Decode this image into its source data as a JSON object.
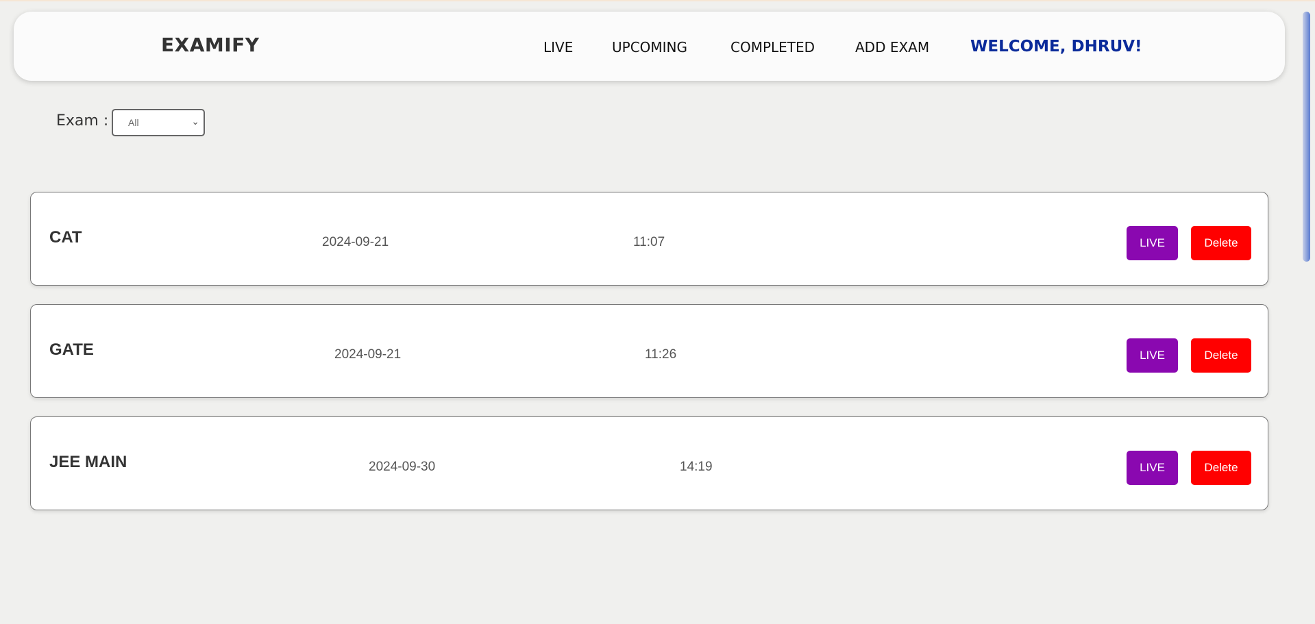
{
  "header": {
    "brand": "EXAMIFY",
    "nav": [
      "LIVE",
      "UPCOMING",
      "COMPLETED",
      "ADD EXAM"
    ],
    "welcome": "WELCOME, DHRUV!"
  },
  "filter": {
    "label": "Exam :",
    "selected": "All"
  },
  "exams": [
    {
      "name": "CAT",
      "date": "2024-09-21",
      "time": "11:07",
      "live_label": "LIVE",
      "delete_label": "Delete"
    },
    {
      "name": "GATE",
      "date": "2024-09-21",
      "time": "11:26",
      "live_label": "LIVE",
      "delete_label": "Delete"
    },
    {
      "name": "JEE MAIN",
      "date": "2024-09-30",
      "time": "14:19",
      "live_label": "LIVE",
      "delete_label": "Delete"
    }
  ],
  "colors": {
    "live": "#8a08b0",
    "delete": "#ff0000",
    "welcome": "#0a2a9a"
  }
}
